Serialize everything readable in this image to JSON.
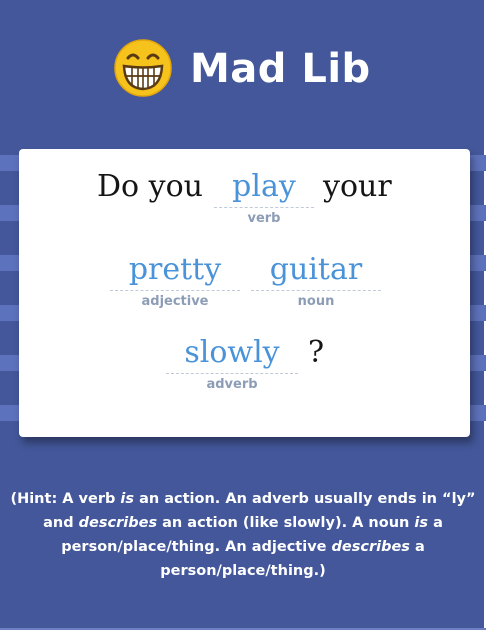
{
  "app": {
    "title": "Mad Lib",
    "logo_icon": "grinning-face-icon"
  },
  "story": {
    "text_1": "Do you",
    "verb": {
      "value": "play",
      "part_of_speech": "verb"
    },
    "text_2": "your",
    "adjective": {
      "value": "pretty",
      "part_of_speech": "adjective"
    },
    "noun": {
      "value": "guitar",
      "part_of_speech": "noun"
    },
    "adverb": {
      "value": "slowly",
      "part_of_speech": "adverb"
    },
    "text_3": "?"
  },
  "hint": {
    "p1": "(Hint: A verb ",
    "e1": "is",
    "p2": " an action. An adverb usually ends in “ly” and ",
    "e2": "describes",
    "p3": " an action (like slowly). A noun ",
    "e3": "is",
    "p4": " a person/place/thing. An adjective ",
    "e4": "describes",
    "p5": " a person/place/thing.)"
  },
  "colors": {
    "background": "#43579a",
    "stripe": "#5d72bc",
    "filled_word": "#4a93d8",
    "part_of_speech_label": "#8d9db6"
  }
}
